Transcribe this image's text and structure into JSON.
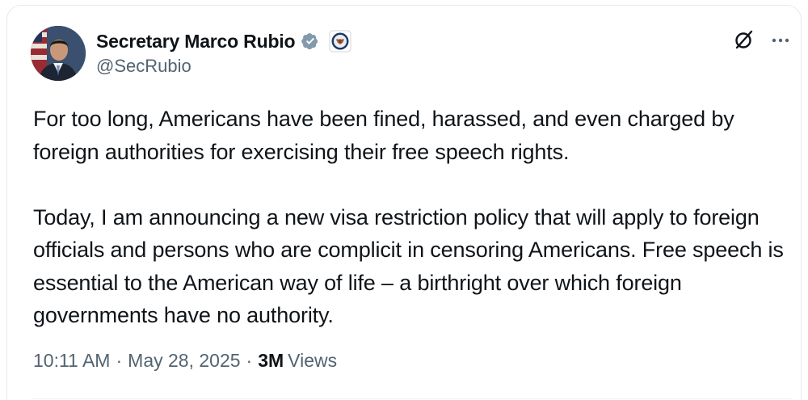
{
  "author": {
    "display_name": "Secretary Marco Rubio",
    "handle": "@SecRubio",
    "verified_badge": "verified-badge-icon",
    "affiliation_badge": "state-department-seal-icon"
  },
  "header_actions": {
    "grok_icon": "grok-icon",
    "more_icon": "more-options-icon"
  },
  "post": {
    "paragraphs": [
      "For too long, Americans have been fined, harassed, and even charged by foreign authorities for exercising their free speech rights.",
      "Today, I am announcing a new visa restriction policy that will apply to foreign officials and persons who are complicit in censoring Americans. Free speech is essential to the American way of life – a birthright over which foreign governments have no authority."
    ]
  },
  "meta": {
    "time": "10:11 AM",
    "date": "May 28, 2025",
    "separator": "·",
    "views_count": "3M",
    "views_label": "Views"
  },
  "colors": {
    "text_primary": "#0f1419",
    "text_secondary": "#536471",
    "verified_gray": "#829aab",
    "border": "#e6e9eb"
  }
}
